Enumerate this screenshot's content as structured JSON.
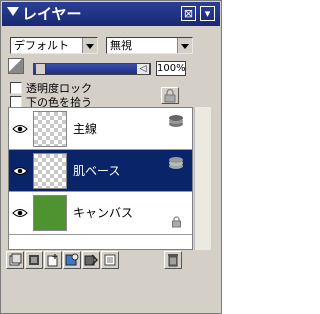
{
  "window": {
    "title": "レイヤー",
    "close_glyph": "⊠",
    "min_glyph": "▾"
  },
  "modes": {
    "preset_value": "デフォルト",
    "blend_value": "無視"
  },
  "opacity": {
    "value_text": "100%",
    "fraction": 1.0
  },
  "options": {
    "transparency_lock_label": "透明度ロック",
    "clip_below_label": "下の色を拾う"
  },
  "layers": [
    {
      "name": "主線",
      "visible": true,
      "selected": false,
      "thumb": "transparent",
      "badge": "stack-icon"
    },
    {
      "name": "肌ベース",
      "visible": true,
      "selected": true,
      "thumb": "transparent",
      "badge": "stack-icon"
    },
    {
      "name": "キャンバス",
      "visible": true,
      "selected": false,
      "thumb": "#4f9330",
      "badge": "lock-icon"
    }
  ],
  "colors": {
    "title_bar": "#1c2d86",
    "selected_row": "#0a246a",
    "canvas_fill": "#4f9330"
  }
}
